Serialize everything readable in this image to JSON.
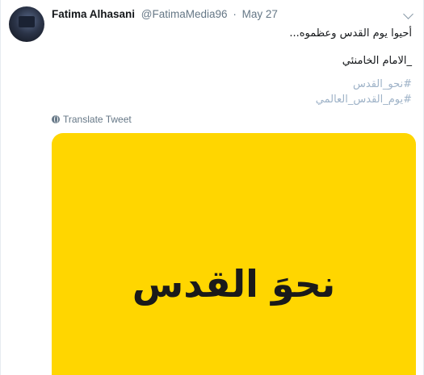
{
  "tweet": {
    "author_name": "Fatima Alhasani",
    "handle": "@FatimaMedia96",
    "separator": "·",
    "date": "May 27",
    "lines": [
      "أحيوا يوم القدس وعظموه...",
      "_الامام الخامنئي"
    ],
    "hashtags": [
      "#نحو_القدس",
      "#يوم_القدس_العالمي"
    ],
    "translate_label": "Translate Tweet",
    "media_text": "نحوَ القدس"
  },
  "colors": {
    "media_background": "#ffd600",
    "hashtag": "#9fb3c8",
    "secondary_text": "#657786"
  },
  "icons": {
    "translate": "globe-icon",
    "more": "chevron-down-icon"
  }
}
